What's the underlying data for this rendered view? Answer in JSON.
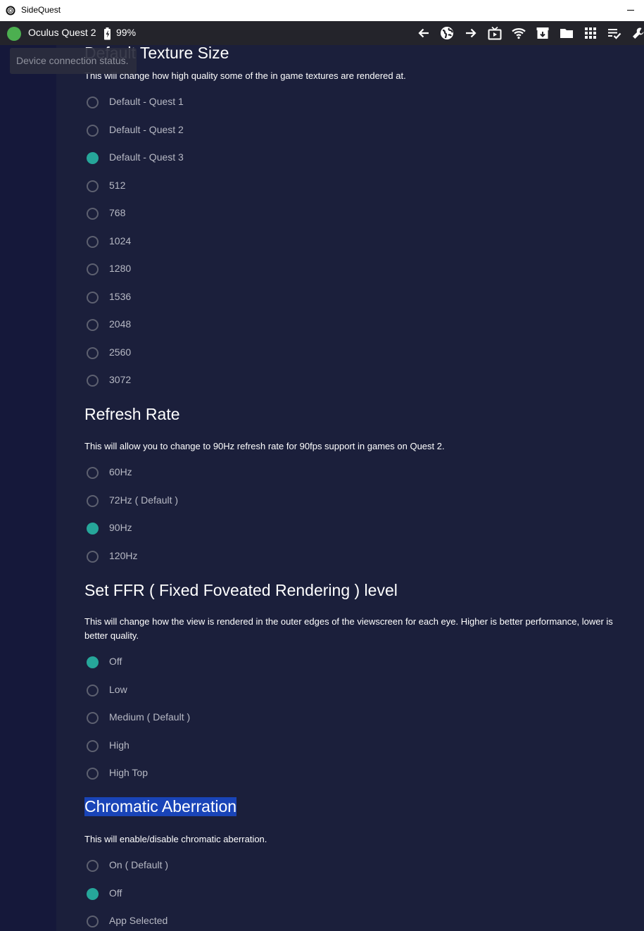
{
  "window": {
    "title": "SideQuest"
  },
  "toolbar": {
    "device_name": "Oculus Quest 2",
    "battery": "99%",
    "status_color": "#4caf50",
    "icons": [
      "back-arrow-icon",
      "globe-icon",
      "forward-arrow-icon",
      "tv-icon",
      "wifi-icon",
      "download-box-icon",
      "folder-icon",
      "grid-icon",
      "checklist-icon",
      "wrench-icon"
    ]
  },
  "tooltip": "Device connection status.",
  "colors": {
    "accent": "#26a69a",
    "selection": "#1944b8"
  },
  "texture": {
    "title": "Default Texture Size",
    "desc": "This will change how high quality some of the in game textures are rendered at.",
    "options": [
      "Default - Quest 1",
      "Default - Quest 2",
      "Default - Quest 3",
      "512",
      "768",
      "1024",
      "1280",
      "1536",
      "2048",
      "2560",
      "3072"
    ],
    "selected": "Default - Quest 3"
  },
  "refresh": {
    "title": "Refresh Rate",
    "desc": "This will allow you to change to 90Hz refresh rate for 90fps support in games on Quest 2.",
    "options": [
      "60Hz",
      "72Hz ( Default )",
      "90Hz",
      "120Hz"
    ],
    "selected": "90Hz"
  },
  "ffr": {
    "title": "Set FFR ( Fixed Foveated Rendering ) level",
    "desc": "This will change how the view is rendered in the outer edges of the viewscreen for each eye. Higher is better performance, lower is better quality.",
    "options": [
      "Off",
      "Low",
      "Medium ( Default )",
      "High",
      "High Top"
    ],
    "selected": "Off"
  },
  "chromatic": {
    "title": "Chromatic Aberration",
    "desc": "This will enable/disable chromatic aberration.",
    "options": [
      "On ( Default )",
      "Off",
      "App Selected"
    ],
    "selected": "Off"
  }
}
